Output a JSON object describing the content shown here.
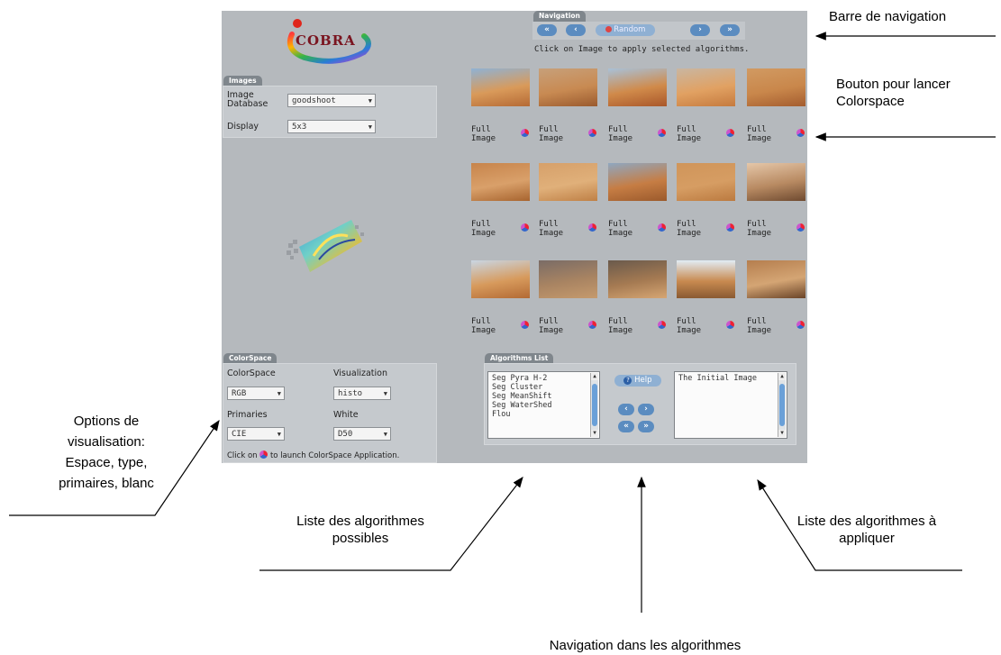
{
  "header": {
    "logo_text": "COBRA",
    "nav_tab": "Navigation",
    "random_label": "Random",
    "nav_hint": "Click on Image to apply selected algorithms."
  },
  "images_panel": {
    "tab": "Images",
    "db_label": "Image Database",
    "db_value": "goodshoot",
    "display_label": "Display",
    "display_value": "5x3"
  },
  "grid": {
    "caption": "Full Image"
  },
  "colorspace_panel": {
    "tab": "ColorSpace",
    "colorspace_label": "ColorSpace",
    "colorspace_value": "RGB",
    "visualization_label": "Visualization",
    "visualization_value": "histo",
    "primaries_label": "Primaries",
    "primaries_value": "CIE",
    "white_label": "White",
    "white_value": "D50",
    "hint_prefix": "Click on",
    "hint_suffix": "to launch ColorSpace Application."
  },
  "algorithms_panel": {
    "tab": "Algorithms List",
    "available": [
      "Seg Pyra H-2",
      "Seg Cluster",
      "Seg MeanShift",
      "Seg WaterShed",
      "Flou"
    ],
    "help_label": "Help",
    "selected": [
      "The Initial Image"
    ]
  },
  "annotations": {
    "nav_bar": "Barre de navigation",
    "colorspace_button": "Bouton pour lancer Colorspace",
    "vis_options": "Options de visualisation: Espace, type, primaires, blanc",
    "possible_algos": "Liste des algorithmes possibles",
    "algo_navigation": "Navigation dans les algorithmes",
    "apply_algos": "Liste des algorithmes à appliquer"
  },
  "colors": {
    "app_bg": "#b5b9bd",
    "panel_bg": "#c5c9cd",
    "tab_bg": "#7f868c",
    "button_blue": "#5b8cc0"
  }
}
